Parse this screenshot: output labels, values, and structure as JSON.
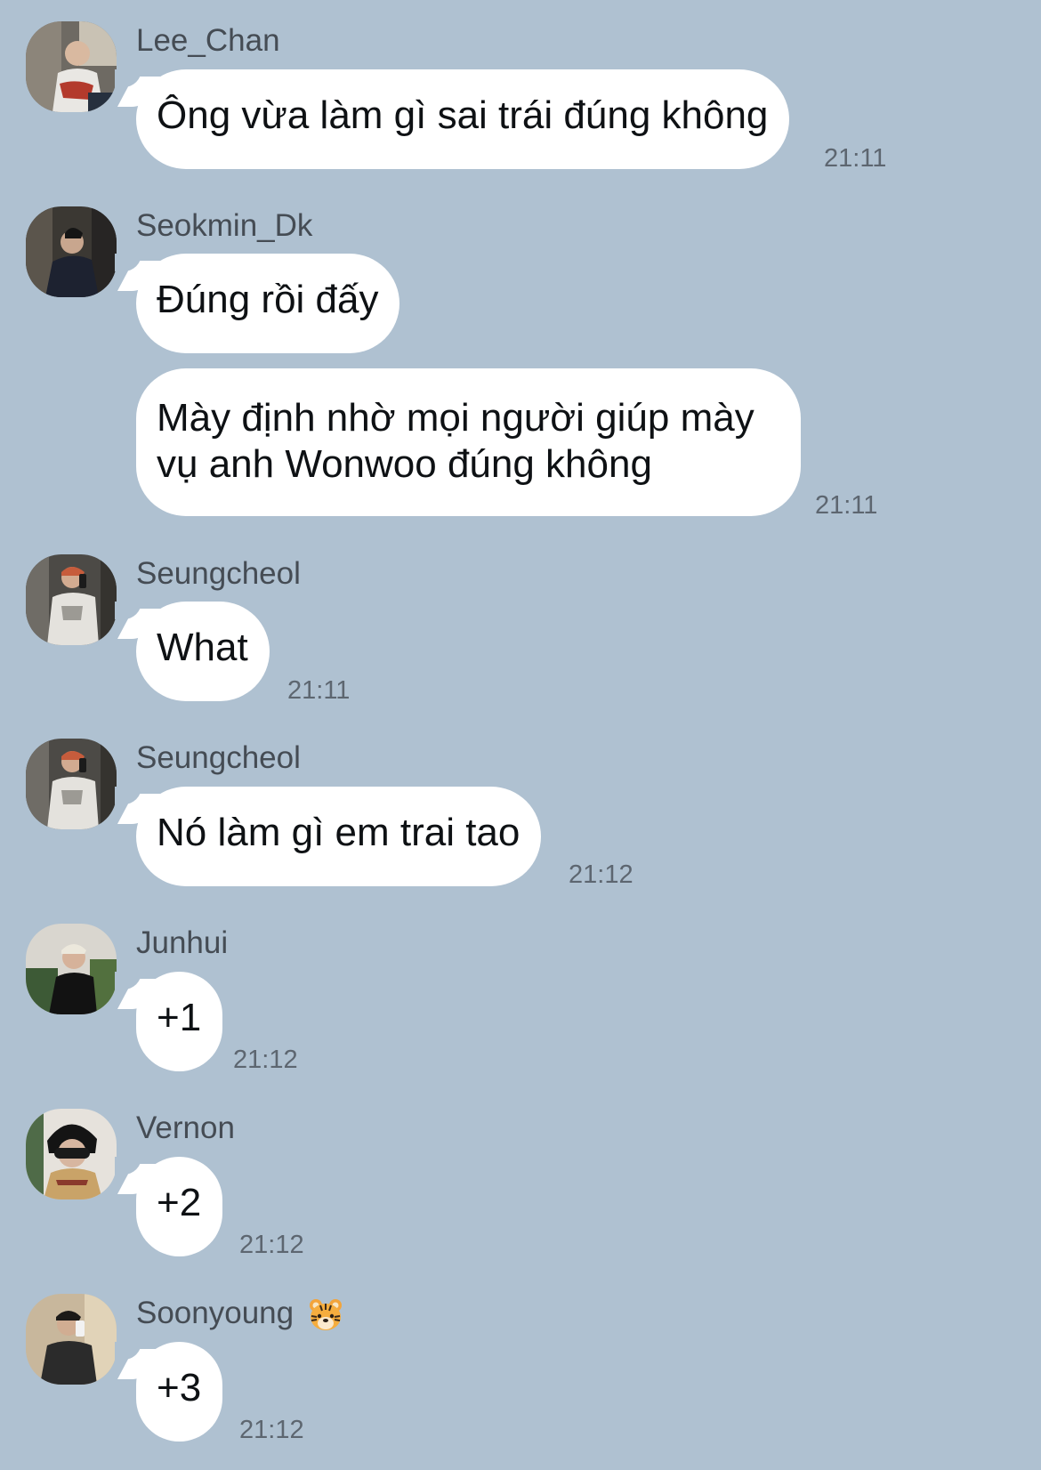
{
  "messages": [
    {
      "sender": "Lee_Chan",
      "text": "Ông vừa làm gì sai trái đúng không",
      "time": "21:11"
    },
    {
      "sender": "Seokmin_Dk",
      "text": "Đúng rồi đấy",
      "time": ""
    },
    {
      "sender": "",
      "text": "Mày định nhờ mọi người giúp mày vụ anh Wonwoo đúng không",
      "line1": "Mày định nhờ mọi người giúp mày",
      "line2": "vụ anh Wonwoo đúng không",
      "time": "21:11"
    },
    {
      "sender": "Seungcheol",
      "text": "What",
      "time": "21:11"
    },
    {
      "sender": "Seungcheol",
      "text": "Nó làm gì em trai tao",
      "time": "21:12"
    },
    {
      "sender": "Junhui",
      "text": "+1",
      "time": "21:12"
    },
    {
      "sender": "Vernon",
      "text": "+2",
      "time": "21:12"
    },
    {
      "sender": "Soonyoung",
      "sender_emoji": "tiger-face-emoji",
      "text": "+3",
      "time": "21:12"
    }
  ],
  "colors": {
    "background": "#afc1d1",
    "bubble": "#ffffff",
    "sender_text": "#454c54",
    "time_text": "#5d6670"
  }
}
